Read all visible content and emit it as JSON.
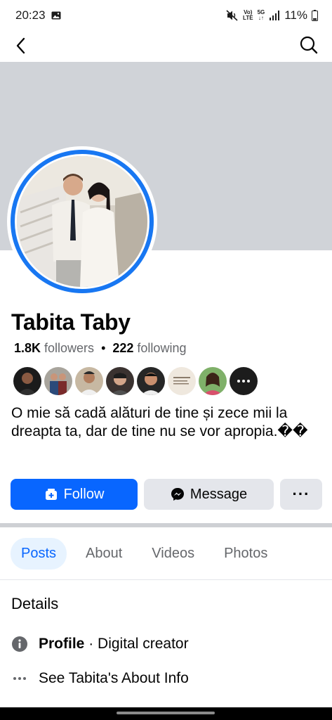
{
  "status_bar": {
    "time": "20:23",
    "network": "5G",
    "battery": "11%"
  },
  "profile": {
    "name": "Tabita Taby",
    "followers_count": "1.8K",
    "followers_label": "followers",
    "separator": "•",
    "following_count": "222",
    "following_label": "following",
    "bio": "O mie să cadă alături de tine și zece mii la dreapta ta, dar de tine nu se vor apropia.��"
  },
  "actions": {
    "follow_label": "Follow",
    "message_label": "Message",
    "more_label": "···"
  },
  "tabs": [
    {
      "label": "Posts",
      "active": true
    },
    {
      "label": "About",
      "active": false
    },
    {
      "label": "Videos",
      "active": false
    },
    {
      "label": "Photos",
      "active": false
    }
  ],
  "details": {
    "title": "Details",
    "profile_label": "Profile",
    "profile_sep": " · ",
    "profile_value": "Digital creator",
    "about_link": "See Tabita's About Info"
  },
  "colors": {
    "accent": "#0866ff",
    "cover": "#d0d3d8",
    "button_bg": "#e4e6eb",
    "tab_active_bg": "#e7f3ff"
  }
}
